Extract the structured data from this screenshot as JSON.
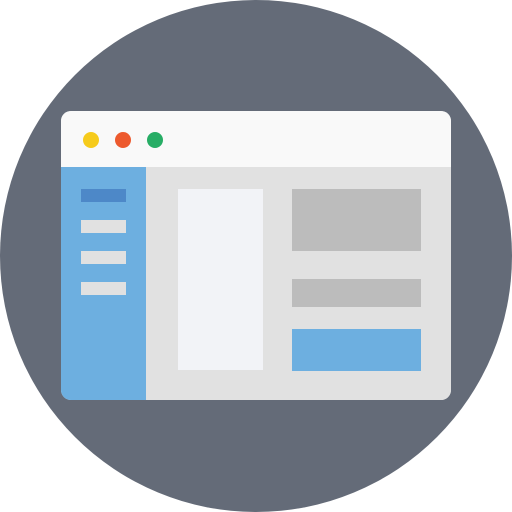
{
  "colors": {
    "circle": "#646b78",
    "titlebar": "#f9f9f9",
    "window_body": "#e1e1e1",
    "dot_yellow": "#f6cb1c",
    "dot_red": "#ed5a2e",
    "dot_green": "#27ad65",
    "sidebar": "#6dafe0",
    "sidebar_active": "#4d88c8",
    "sidebar_item": "#e1e1e1",
    "panel_left": "#f2f3f7",
    "block_gray": "#bcbcbc",
    "block_blue": "#6dafe0"
  },
  "window": {
    "controls": [
      "close-icon",
      "minimize-icon",
      "maximize-icon"
    ],
    "sidebar_items": [
      "active-item",
      "item",
      "item",
      "item"
    ]
  }
}
